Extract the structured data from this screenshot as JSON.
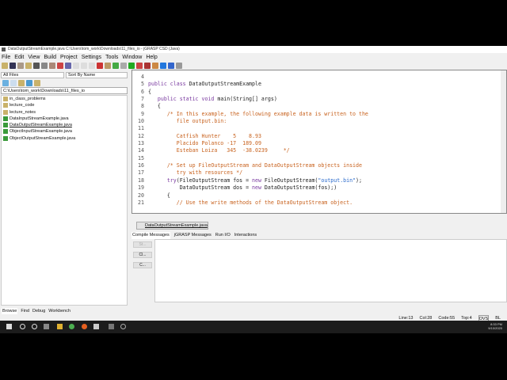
{
  "window": {
    "title": "DataOutputStreamExample.java  C:\\Users\\tom_work\\Downloads\\11_files_io - jGRASP CSD (Java)"
  },
  "menu": [
    "File",
    "Edit",
    "View",
    "Build",
    "Project",
    "Settings",
    "Tools",
    "Window",
    "Help"
  ],
  "browser": {
    "filter": "All Files",
    "sort": "Sort By Name",
    "path": "C:\\Users\\tom_work\\Downloads\\11_files_io",
    "items": [
      {
        "name": "in_class_problems",
        "type": "folder"
      },
      {
        "name": "lecture_code",
        "type": "folder"
      },
      {
        "name": "lecture_notes",
        "type": "folder"
      },
      {
        "name": "DataInputStreamExample.java",
        "type": "java"
      },
      {
        "name": "DataOutputStreamExample.java",
        "type": "java"
      },
      {
        "name": "ObjectInputStreamExample.java",
        "type": "java"
      },
      {
        "name": "ObjectOutputStreamExample.java",
        "type": "java"
      }
    ]
  },
  "code": [
    {
      "n": "4",
      "t": []
    },
    {
      "n": "5",
      "t": [
        [
          "k",
          "public class "
        ],
        [
          "n",
          "DataOutputStreamExample"
        ]
      ]
    },
    {
      "n": "6",
      "t": [
        [
          "n",
          "{"
        ]
      ]
    },
    {
      "n": "7",
      "t": [
        [
          "n",
          "   "
        ],
        [
          "k",
          "public static void "
        ],
        [
          "n",
          "main(String[] args)"
        ]
      ]
    },
    {
      "n": "8",
      "t": [
        [
          "n",
          "   {"
        ]
      ]
    },
    {
      "n": "9",
      "t": [
        [
          "c",
          "      /* In this example, the following example data is written to the"
        ]
      ]
    },
    {
      "n": "10",
      "t": [
        [
          "c",
          "         file output.bin:"
        ]
      ]
    },
    {
      "n": "11",
      "t": []
    },
    {
      "n": "12",
      "t": [
        [
          "c",
          "         Catfish Hunter    5    8.93"
        ]
      ]
    },
    {
      "n": "13",
      "t": [
        [
          "c",
          "         Placido Polanco -17  189.09"
        ]
      ]
    },
    {
      "n": "14",
      "t": [
        [
          "c",
          "         Esteban Loiza   345  -38.0239     */"
        ]
      ]
    },
    {
      "n": "15",
      "t": []
    },
    {
      "n": "16",
      "t": [
        [
          "c",
          "      /* Set up FileOutputStream and DataOutputStream objects inside"
        ]
      ]
    },
    {
      "n": "17",
      "t": [
        [
          "c",
          "         try with resources */"
        ]
      ]
    },
    {
      "n": "18",
      "t": [
        [
          "k",
          "      try"
        ],
        [
          "n",
          "(FileOutputStream fos = "
        ],
        [
          "k",
          "new "
        ],
        [
          "n",
          "FileOutputStream("
        ],
        [
          "s",
          "\"output.bin\""
        ],
        [
          "n",
          ");"
        ]
      ]
    },
    {
      "n": "19",
      "t": [
        [
          "n",
          "          DataOutputStream dos = "
        ],
        [
          "k",
          "new "
        ],
        [
          "n",
          "DataOutputStream(fos);)"
        ]
      ]
    },
    {
      "n": "20",
      "t": [
        [
          "n",
          "      {"
        ]
      ]
    },
    {
      "n": "21",
      "t": [
        [
          "c",
          "         // Use the write methods of the DataOutputStream object."
        ]
      ]
    }
  ],
  "file_tab": "DataOutputStreamExample.java",
  "message_tabs": [
    "Compile Messages",
    "jGRASP Messages",
    "Run I/O",
    "Interactions"
  ],
  "message_buttons": [
    "St...",
    "Cl...",
    "C..."
  ],
  "bottom_tabs": [
    "Browse",
    "Find",
    "Debug",
    "Workbench"
  ],
  "status": {
    "line": "Line:13",
    "col": "Col:28",
    "code": "Code:55",
    "top": "Top:4",
    "mode1": "OVS",
    "mode2": "BL"
  },
  "clock": {
    "time": "8:33 PM",
    "date": "9/10/2020"
  }
}
